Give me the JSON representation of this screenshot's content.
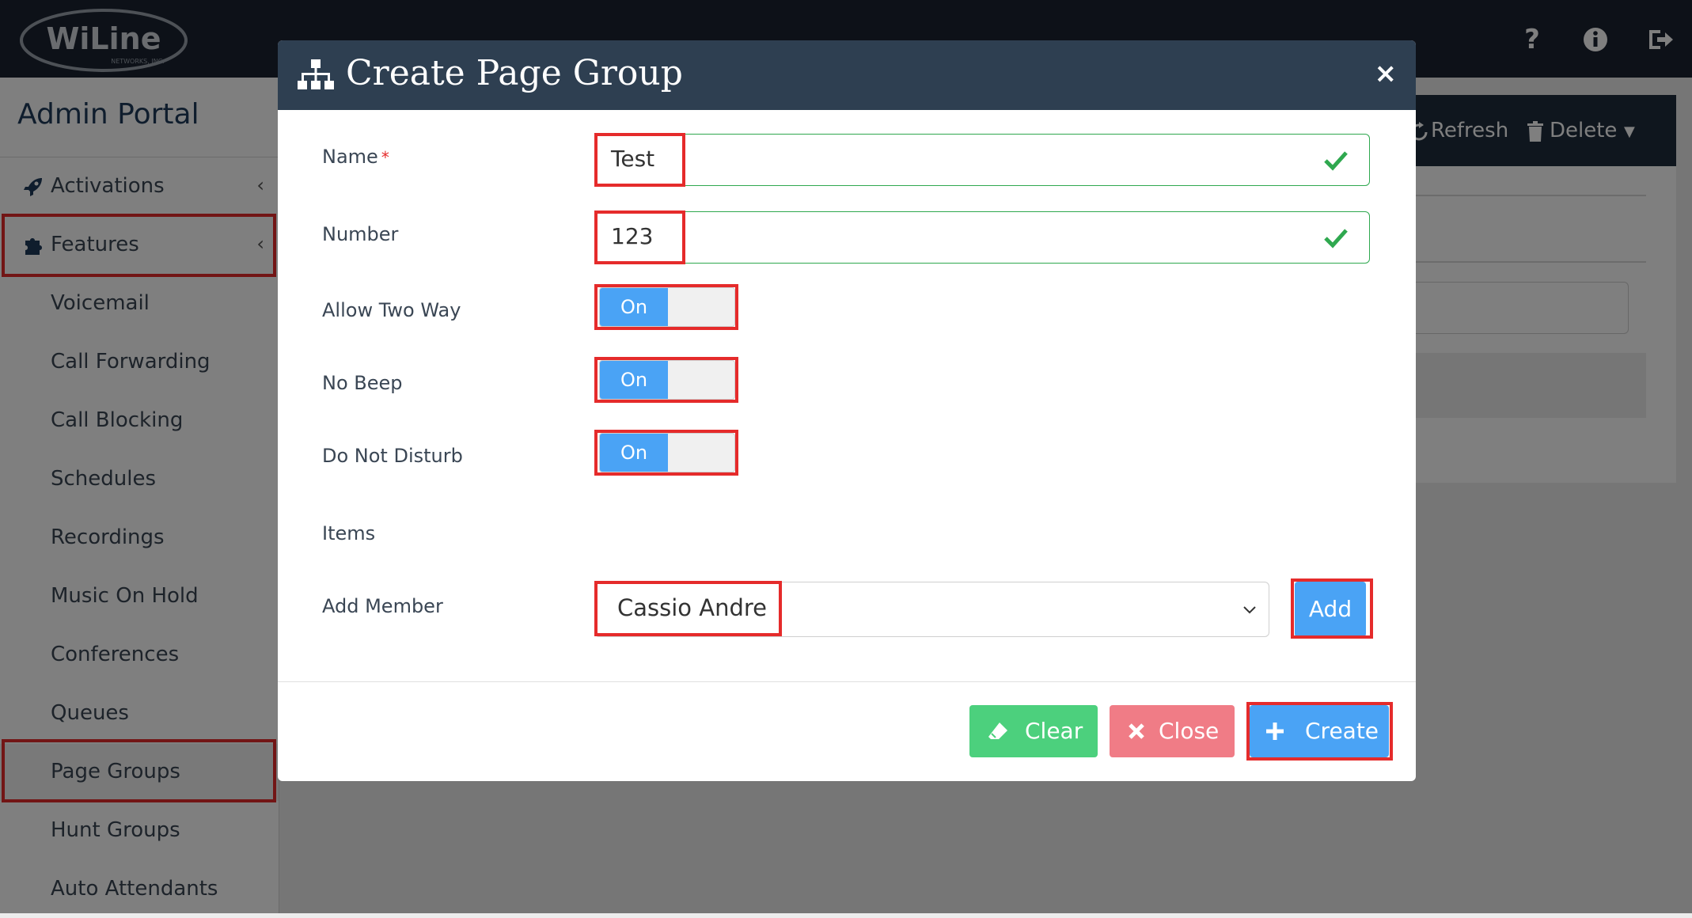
{
  "header": {
    "logo_text": "WiLine",
    "logo_subtext": "NETWORKS, INC.",
    "icons": [
      "help-icon",
      "info-icon",
      "logout-icon"
    ]
  },
  "sidebar": {
    "portal_title": "Admin Portal",
    "items": [
      {
        "label": "Activations",
        "icon": "rocket-icon",
        "chevron": "‹"
      },
      {
        "label": "Features",
        "icon": "puzzle-icon",
        "chevron": "‹"
      }
    ],
    "sub_items": [
      "Voicemail",
      "Call Forwarding",
      "Call Blocking",
      "Schedules",
      "Recordings",
      "Music On Hold",
      "Conferences",
      "Queues",
      "Page Groups",
      "Hunt Groups",
      "Auto Attendants"
    ]
  },
  "background_toolbar": {
    "refresh_label": "Refresh",
    "delete_label": "Delete"
  },
  "modal": {
    "title": "Create Page Group",
    "close_symbol": "×",
    "fields": {
      "name_label": "Name",
      "name_required": "*",
      "name_value": "Test",
      "number_label": "Number",
      "number_value": "123",
      "allow_two_way_label": "Allow Two Way",
      "allow_two_way_state": "On",
      "no_beep_label": "No Beep",
      "no_beep_state": "On",
      "dnd_label": "Do Not Disturb",
      "dnd_state": "On",
      "items_label": "Items",
      "add_member_label": "Add Member",
      "add_member_value": "Cassio Andre",
      "add_button": "Add"
    },
    "footer": {
      "clear_label": "Clear",
      "close_label": "Close",
      "create_label": "Create"
    }
  },
  "colors": {
    "topbar": "#1a2230",
    "modal_header": "#2e3f51",
    "primary": "#4aa3f5",
    "success": "#4cd07d",
    "danger": "#f07c86",
    "valid_border": "#2fa84f",
    "highlight": "#e52b2b"
  }
}
